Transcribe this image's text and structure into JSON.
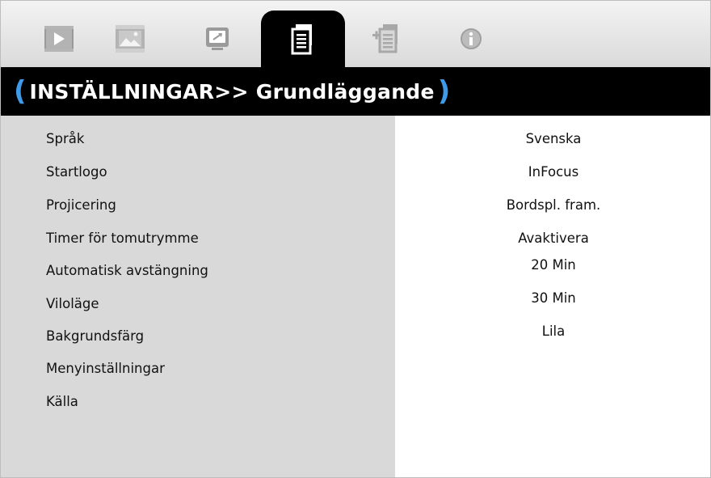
{
  "tabs": [
    {
      "name": "image-tab",
      "icon": "play-icon"
    },
    {
      "name": "display-tab",
      "icon": "picture-icon"
    },
    {
      "name": "screen-tab",
      "icon": "monitor-icon"
    },
    {
      "name": "setup-basic-tab",
      "icon": "document-icon",
      "active": true
    },
    {
      "name": "setup-advanced-tab",
      "icon": "document-plus-icon"
    },
    {
      "name": "info-tab",
      "icon": "info-icon"
    }
  ],
  "header": {
    "open_paren": "(",
    "title": "INSTÄLLNINGAR>> Grundläggande",
    "close_paren": ")"
  },
  "settings": [
    {
      "label": "Språk",
      "value": "Svenska"
    },
    {
      "label": "Startlogo",
      "value": "InFocus"
    },
    {
      "label": "Projicering",
      "value": "Bordspl. fram."
    },
    {
      "label": "Timer för tomutrymme",
      "value": "Avaktivera"
    },
    {
      "label": "Automatisk avstängning",
      "value": "20 Min"
    },
    {
      "label": "Viloläge",
      "value": "30 Min"
    },
    {
      "label": "Bakgrundsfärg",
      "value": "Lila"
    },
    {
      "label": "Menyinställningar",
      "value": ""
    },
    {
      "label": "Källa",
      "value": ""
    }
  ],
  "colors": {
    "accent": "#3f9be8",
    "left_pane": "#d9d9d9",
    "title_bar": "#000000"
  }
}
